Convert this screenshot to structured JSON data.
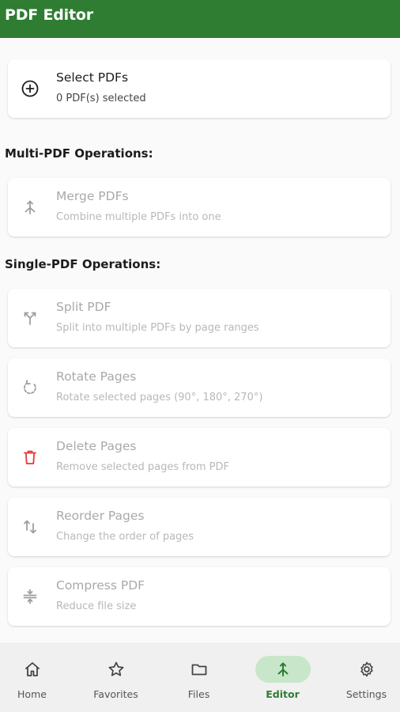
{
  "app": {
    "title": "PDF Editor"
  },
  "select_card": {
    "title": "Select PDFs",
    "subtitle": "0 PDF(s) selected"
  },
  "multi_section": {
    "label": "Multi-PDF Operations:",
    "items": [
      {
        "title": "Merge PDFs",
        "subtitle": "Combine multiple PDFs into one",
        "icon": "merge-icon"
      }
    ]
  },
  "single_section": {
    "label": "Single-PDF Operations:",
    "items": [
      {
        "title": "Split PDF",
        "subtitle": "Split into multiple PDFs by page ranges",
        "icon": "split-icon"
      },
      {
        "title": "Rotate Pages",
        "subtitle": "Rotate selected pages (90°, 180°, 270°)",
        "icon": "rotate-icon"
      },
      {
        "title": "Delete Pages",
        "subtitle": "Remove selected pages from PDF",
        "icon": "trash-icon"
      },
      {
        "title": "Reorder Pages",
        "subtitle": "Change the order of pages",
        "icon": "swap-vert-icon"
      },
      {
        "title": "Compress PDF",
        "subtitle": "Reduce file size",
        "icon": "compress-icon"
      }
    ]
  },
  "bottom_nav": {
    "active": "Editor",
    "items": [
      {
        "label": "Home",
        "icon": "home-icon"
      },
      {
        "label": "Favorites",
        "icon": "star-icon"
      },
      {
        "label": "Files",
        "icon": "folder-icon"
      },
      {
        "label": "Editor",
        "icon": "merge-icon"
      },
      {
        "label": "Settings",
        "icon": "gear-icon"
      }
    ]
  },
  "colors": {
    "primary": "#2e7d32",
    "active_pill": "#c8e6c9",
    "delete_red": "#e53935",
    "disabled_text": "#a9a9a9",
    "disabled_icon": "#9e9e9e"
  }
}
